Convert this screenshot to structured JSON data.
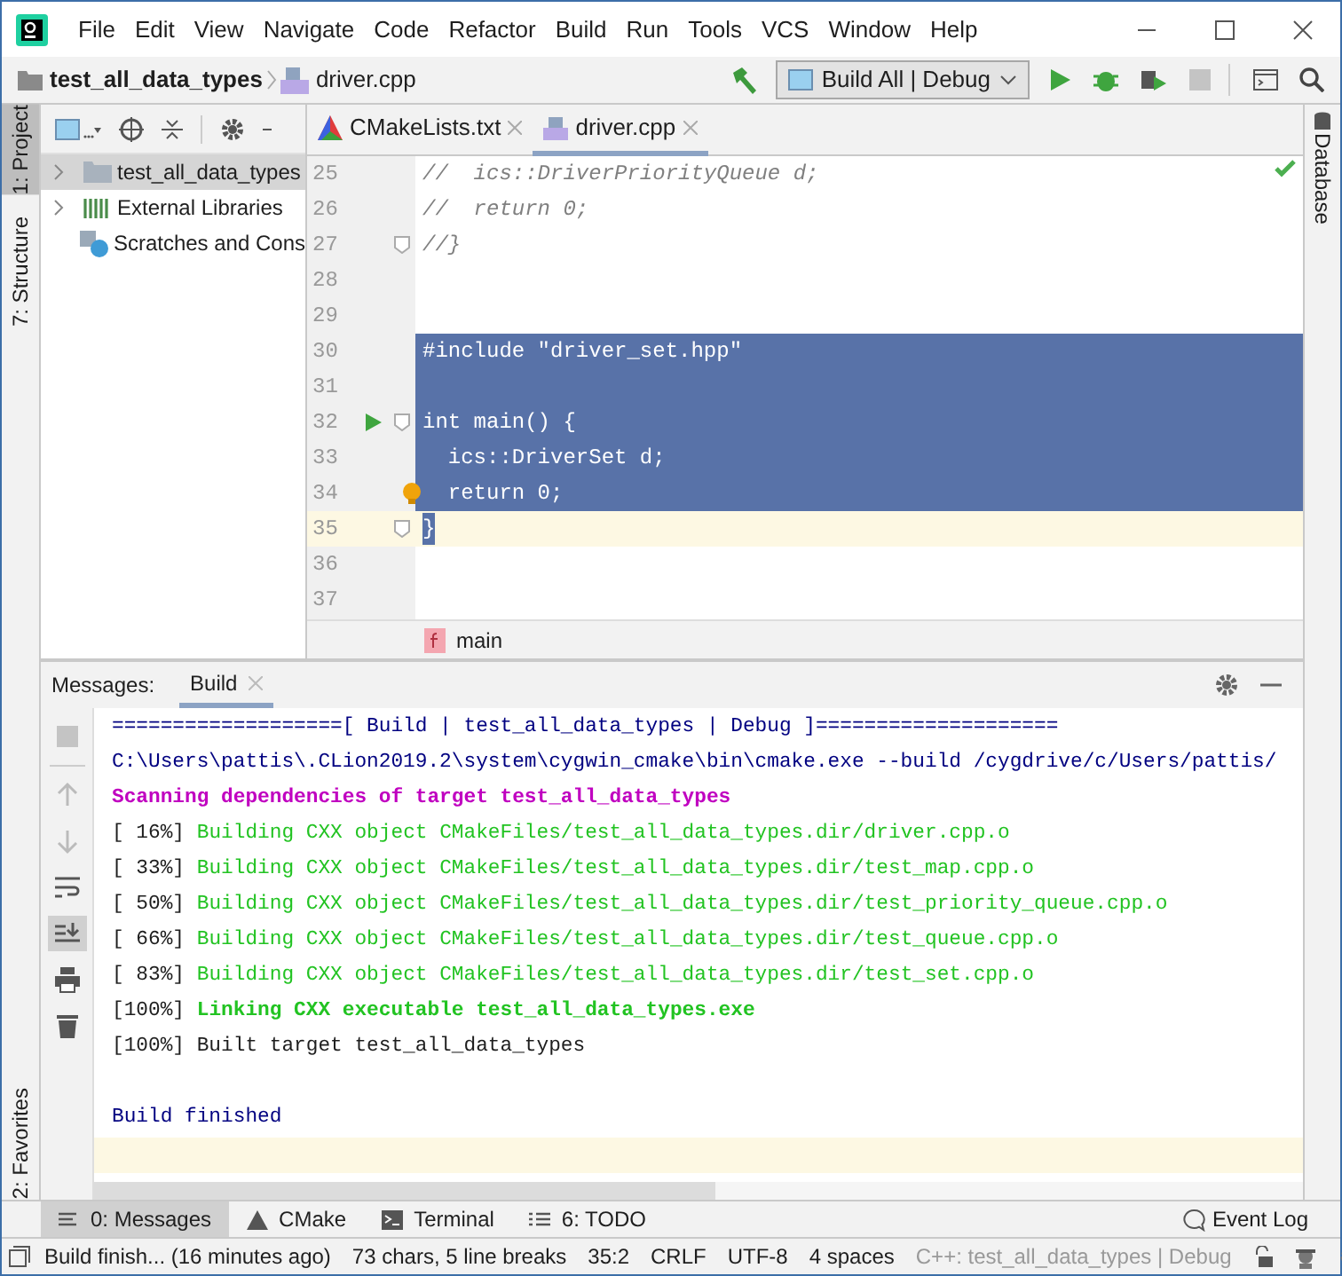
{
  "menu": [
    "File",
    "Edit",
    "View",
    "Navigate",
    "Code",
    "Refactor",
    "Build",
    "Run",
    "Tools",
    "VCS",
    "Window",
    "Help"
  ],
  "breadcrumb": {
    "project": "test_all_data_types",
    "file": "driver.cpp"
  },
  "run_config": {
    "label": "Build All | Debug"
  },
  "left_tabs": [
    {
      "label": "1: Project",
      "selected": true
    },
    {
      "label": "7: Structure",
      "selected": false
    }
  ],
  "bottom_left_tabs": [
    {
      "label": "2: Favorites",
      "selected": false
    }
  ],
  "right_tabs": [
    {
      "label": "Database",
      "selected": false
    }
  ],
  "project_tree": [
    {
      "label": "test_all_data_types",
      "kind": "folder",
      "expanded": false,
      "selected": true
    },
    {
      "label": "External Libraries",
      "kind": "library",
      "expanded": false,
      "selected": false
    },
    {
      "label": "Scratches and Cons",
      "kind": "scratch",
      "selected": false
    }
  ],
  "editor_tabs": [
    {
      "label": "CMakeLists.txt",
      "kind": "cmake",
      "selected": false
    },
    {
      "label": "driver.cpp",
      "kind": "cpp",
      "selected": true
    }
  ],
  "code_lines": [
    {
      "number": "25",
      "text": "//  ics::DriverPriorityQueue d;",
      "kind": "comment",
      "selected": false
    },
    {
      "number": "26",
      "text": "//  return 0;",
      "kind": "comment",
      "selected": false
    },
    {
      "number": "27",
      "text": "//}",
      "kind": "comment",
      "fold": true,
      "selected": false
    },
    {
      "number": "28",
      "kind": "code",
      "selected": false
    },
    {
      "number": "29",
      "kind": "code",
      "selected": false
    },
    {
      "number": "30",
      "text": "#include \"driver_set.hpp\"",
      "kind": "code",
      "selected": true
    },
    {
      "number": "31",
      "kind": "code",
      "selected": true
    },
    {
      "number": "32",
      "text": "int main() {",
      "kind": "code",
      "selected": true,
      "fold": true,
      "run_marker": true
    },
    {
      "number": "33",
      "text": "  ics::DriverSet d;",
      "kind": "code",
      "selected": true
    },
    {
      "number": "34",
      "text": "  return 0;",
      "kind": "code",
      "selected": true,
      "bulb": true
    },
    {
      "number": "35",
      "text": "}",
      "kind": "code",
      "selected": true,
      "fold": true,
      "current": true
    },
    {
      "number": "36",
      "kind": "code",
      "selected": false
    },
    {
      "number": "37",
      "kind": "code",
      "selected": false
    }
  ],
  "editor_breadcrumb": {
    "label": "main"
  },
  "messages_panel": {
    "title": "Messages:",
    "tabs": [
      {
        "label": "Build",
        "selected": true
      }
    ]
  },
  "output_lines": [
    {
      "kind": "info",
      "text": "===================[ Build | test_all_data_types | Debug ]===================="
    },
    {
      "kind": "info",
      "text": "C:\\Users\\pattis\\.CLion2019.2\\system\\cygwin_cmake\\bin\\cmake.exe --build /cygdrive/c/Users/pattis/"
    },
    {
      "kind": "scan",
      "text": "Scanning dependencies of target test_all_data_types"
    },
    {
      "kind": "progress",
      "prefix": "[ 16%]",
      "text": "Building CXX object CMakeFiles/test_all_data_types.dir/driver.cpp.o"
    },
    {
      "kind": "progress",
      "prefix": "[ 33%]",
      "text": "Building CXX object CMakeFiles/test_all_data_types.dir/test_map.cpp.o"
    },
    {
      "kind": "progress",
      "prefix": "[ 50%]",
      "text": "Building CXX object CMakeFiles/test_all_data_types.dir/test_priority_queue.cpp.o"
    },
    {
      "kind": "progress",
      "prefix": "[ 66%]",
      "text": "Building CXX object CMakeFiles/test_all_data_types.dir/test_queue.cpp.o"
    },
    {
      "kind": "progress",
      "prefix": "[ 83%]",
      "text": "Building CXX object CMakeFiles/test_all_data_types.dir/test_set.cpp.o"
    },
    {
      "kind": "link",
      "prefix": "[100%]",
      "text": "Linking CXX executable test_all_data_types.exe"
    },
    {
      "kind": "plain",
      "text": "[100%] Built target test_all_data_types"
    },
    {
      "kind": "blank"
    },
    {
      "kind": "info",
      "text": "Build finished"
    },
    {
      "kind": "current"
    }
  ],
  "tool_tabs": [
    {
      "label": "0: Messages",
      "kind": "messages",
      "selected": true
    },
    {
      "label": "CMake",
      "kind": "cmake",
      "selected": false
    },
    {
      "label": "Terminal",
      "kind": "terminal",
      "selected": false
    },
    {
      "label": "6: TODO",
      "kind": "todo",
      "selected": false
    }
  ],
  "event_log": "Event Log",
  "status_bar": {
    "message": "Build finish... (16 minutes ago)",
    "selection": "73 chars, 5 line breaks",
    "position": "35:2",
    "line_sep": "CRLF",
    "encoding": "UTF-8",
    "indent": "4 spaces",
    "context": "C++: test_all_data_types | Debug"
  }
}
